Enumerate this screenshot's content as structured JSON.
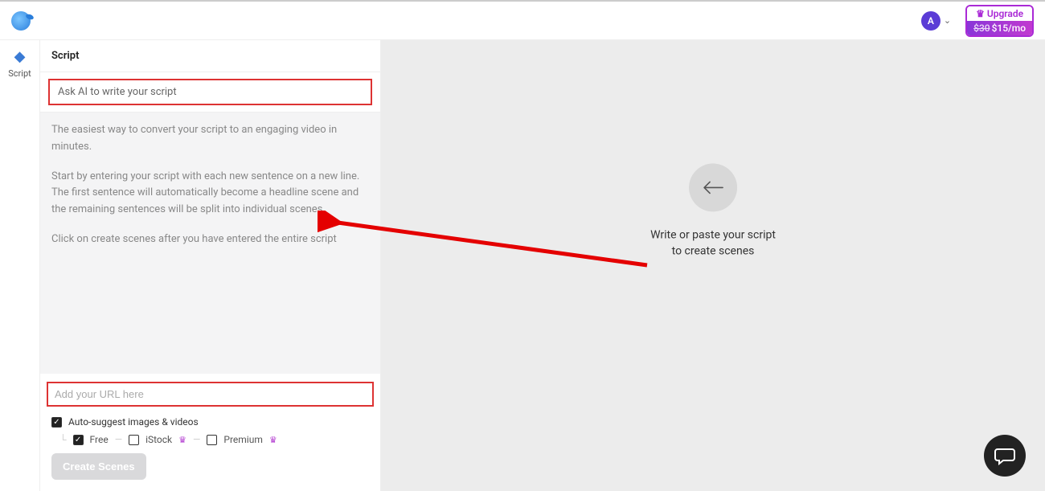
{
  "topbar": {
    "avatar_initial": "A",
    "upgrade_label": "Upgrade",
    "upgrade_old_price": "$30",
    "upgrade_new_price": "$15/mo"
  },
  "rail": {
    "script_label": "Script"
  },
  "panel": {
    "title": "Script",
    "ask_ai_label": "Ask AI to write your script",
    "placeholder_p1": "The easiest way to convert your script to an engaging video in minutes.",
    "placeholder_p2": "Start by entering your script with each new sentence on a new line. The first sentence will automatically become a headline scene and the remaining sentences will be split into individual scenes.",
    "placeholder_p3": "Click on create scenes after you have entered the entire script",
    "url_placeholder": "Add your URL here",
    "auto_suggest_label": "Auto-suggest images & videos",
    "opt_free": "Free",
    "opt_istock": "iStock",
    "opt_premium": "Premium",
    "create_button": "Create Scenes"
  },
  "canvas": {
    "hint_line1": "Write or paste your script",
    "hint_line2": "to create scenes"
  }
}
